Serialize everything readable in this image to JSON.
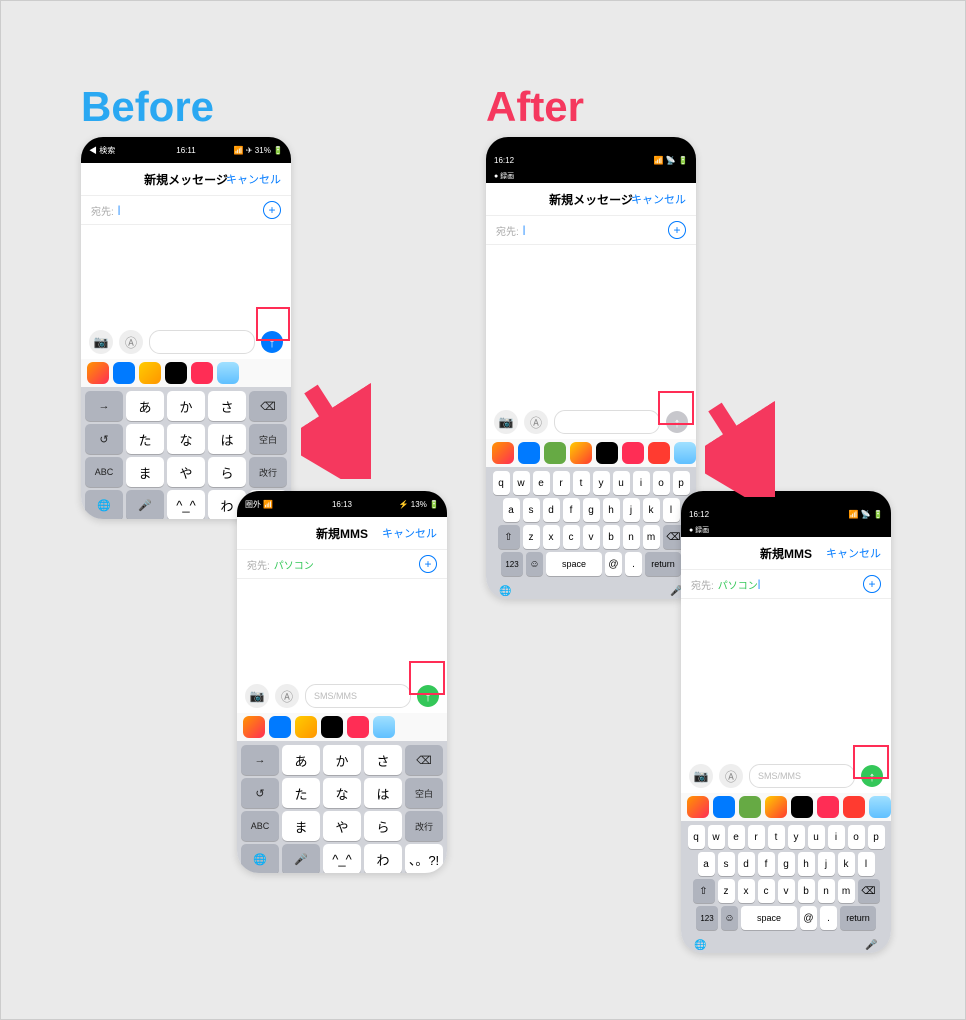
{
  "headings": {
    "before": "Before",
    "after": "After"
  },
  "status": {
    "time1": "16:11",
    "time2": "16:13",
    "time3": "16:12",
    "time4": "16:12",
    "back": "◀ 検索",
    "batt1": "31%",
    "batt2": "13%",
    "rec": "● 録画"
  },
  "title": {
    "new_msg": "新規メッセージ",
    "new_mms": "新規MMS",
    "cancel": "キャンセル"
  },
  "to": {
    "label": "宛先:",
    "chip": "パソコン"
  },
  "input": {
    "smsmms": "SMS/MMS"
  },
  "kana": {
    "r1": [
      "あ",
      "か",
      "さ"
    ],
    "r2": [
      "た",
      "な",
      "は"
    ],
    "r3": [
      "ま",
      "や",
      "ら"
    ],
    "r4": [
      "^_^",
      "わ",
      "、。?!"
    ],
    "side_upL": "→",
    "side_upR": "⌫",
    "side_spc": "空白",
    "side_ret": "改行",
    "side_abc": "ABC",
    "side_undo": "↺",
    "side_globe": "🌐",
    "side_mic": "🎤"
  },
  "qwerty": {
    "r1": [
      "q",
      "w",
      "e",
      "r",
      "t",
      "y",
      "u",
      "i",
      "o",
      "p"
    ],
    "r2": [
      "a",
      "s",
      "d",
      "f",
      "g",
      "h",
      "j",
      "k",
      "l"
    ],
    "r3": [
      "z",
      "x",
      "c",
      "v",
      "b",
      "n",
      "m"
    ],
    "shift": "⇧",
    "del": "⌫",
    "num": "123",
    "emoji": "☺",
    "space": "space",
    "at": "@",
    "dot": ".",
    "ret": "return",
    "globe": "🌐",
    "mic": "🎤"
  },
  "apps": [
    {
      "c": "linear-gradient(135deg,#ff9500,#ff2d55)"
    },
    {
      "c": "#007aff"
    },
    {
      "c": "linear-gradient(135deg,#ffcc00,#ff9500)"
    },
    {
      "c": "#000"
    },
    {
      "c": "#ff2d55"
    },
    {
      "c": "linear-gradient(#a0e0ff,#60c0ff)"
    }
  ],
  "apps2": [
    {
      "c": "linear-gradient(135deg,#ff9500,#ff2d55)"
    },
    {
      "c": "#007aff"
    },
    {
      "c": "#6a4"
    },
    {
      "c": "linear-gradient(135deg,#ffcc00,#ff3b30)"
    },
    {
      "c": "#000"
    },
    {
      "c": "#ff2d55"
    },
    {
      "c": "#ff3b30"
    },
    {
      "c": "linear-gradient(#a0e0ff,#60c0ff)"
    }
  ]
}
